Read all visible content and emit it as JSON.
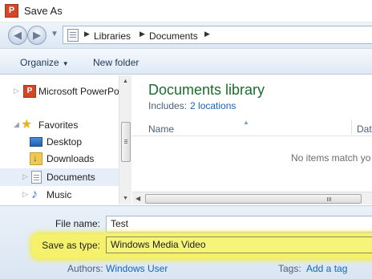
{
  "window": {
    "title": "Save As",
    "app_icon_letter": "P"
  },
  "address": {
    "crumbs": [
      "Libraries",
      "Documents"
    ]
  },
  "toolbar": {
    "organize": "Organize",
    "new_folder": "New folder"
  },
  "navpane": {
    "items": [
      {
        "label": "Microsoft PowerPo",
        "icon": "powerpoint-icon"
      },
      {
        "label": "Favorites",
        "icon": "star-icon"
      },
      {
        "label": "Desktop",
        "icon": "desktop-icon"
      },
      {
        "label": "Downloads",
        "icon": "downloads-icon"
      },
      {
        "label": "Documents",
        "icon": "documents-icon",
        "selected": true
      },
      {
        "label": "Music",
        "icon": "music-icon"
      }
    ]
  },
  "content": {
    "library_title": "Documents library",
    "includes_label": "Includes:",
    "includes_link": "2 locations",
    "columns": [
      "Name",
      "Dat"
    ],
    "empty_message": "No items match yo"
  },
  "form": {
    "filename_label": "File name:",
    "filename_value": "Test",
    "savetype_label": "Save as type:",
    "savetype_value": "Windows Media Video",
    "authors_label": "Authors:",
    "authors_value": "Windows User",
    "tags_label": "Tags:",
    "tags_value": "Add a tag"
  },
  "colors": {
    "highlight": "#f5f16c",
    "library_title": "#1e6b2f",
    "link": "#1565c0"
  }
}
